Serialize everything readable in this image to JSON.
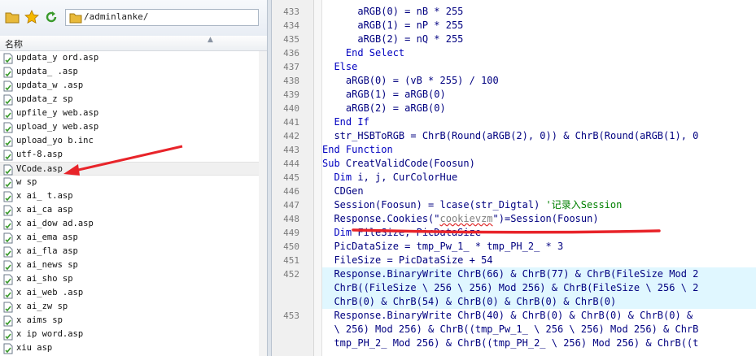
{
  "toolbar": {
    "path": "/adminlanke/",
    "icons": [
      "folder-icon",
      "star-icon",
      "refresh-icon"
    ]
  },
  "filelist": {
    "column_header": "名称",
    "files": [
      "updata_y     ord.asp",
      "updata_     .asp",
      "updata_w     .asp",
      "updata_z    sp",
      "upfile_y    web.asp",
      "upload_y    web.asp",
      "upload_yo     b.inc",
      "utf-8.asp",
      "VCode.asp",
      "w       sp",
      "x     ai_     t.asp",
      "x     ai_ca     asp",
      "x     ai_dow     ad.asp",
      "x     ai_ema     asp",
      "x     ai_fla     asp",
      "x     ai_news     sp",
      "x     ai_sho     sp",
      "x     ai_web     .asp",
      "x     ai_zw     sp",
      "x     aims     sp",
      "x     ip     word.asp",
      "xiu       asp"
    ],
    "selected_index": 8
  },
  "editor": {
    "lines": [
      {
        "num": "433",
        "text": "      aRGB(0) = nB * 255"
      },
      {
        "num": "434",
        "text": "      aRGB(1) = nP * 255"
      },
      {
        "num": "435",
        "text": "      aRGB(2) = nQ * 255"
      },
      {
        "num": "436",
        "text": "    End Select"
      },
      {
        "num": "437",
        "text": "  Else"
      },
      {
        "num": "438",
        "text": "    aRGB(0) = (vB * 255) / 100"
      },
      {
        "num": "439",
        "text": "    aRGB(1) = aRGB(0)"
      },
      {
        "num": "440",
        "text": "    aRGB(2) = aRGB(0)"
      },
      {
        "num": "441",
        "text": "  End If"
      },
      {
        "num": "442",
        "text": "  str_HSBToRGB = ChrB(Round(aRGB(2), 0)) & ChrB(Round(aRGB(1), 0"
      },
      {
        "num": "443",
        "text": "End Function"
      },
      {
        "num": "444",
        "text": "Sub CreatValidCode(Foosun)"
      },
      {
        "num": "445",
        "text": "  Dim i, j, CurColorHue"
      },
      {
        "num": "446",
        "text": "  CDGen"
      },
      {
        "num": "447",
        "text": "  Session(Foosun) = lcase(str_Digtal) '记录入Session"
      },
      {
        "num": "448",
        "text": "  Response.Cookies(\"cookievzm\")=Session(Foosun)"
      },
      {
        "num": "449",
        "text": "  Dim FileSize, PicDataSize"
      },
      {
        "num": "450",
        "text": "  PicDataSize = tmp_Pw_1_ * tmp_PH_2_ * 3"
      },
      {
        "num": "451",
        "text": "  FileSize = PicDataSize + 54"
      },
      {
        "num": "452",
        "text": "  Response.BinaryWrite ChrB(66) & ChrB(77) & ChrB(FileSize Mod 2"
      },
      {
        "num": "",
        "text": "  ChrB((FileSize \\ 256 \\ 256) Mod 256) & ChrB(FileSize \\ 256 \\ 2"
      },
      {
        "num": "",
        "text": "  ChrB(0) & ChrB(54) & ChrB(0) & ChrB(0) & ChrB(0)"
      },
      {
        "num": "453",
        "text": "  Response.BinaryWrite ChrB(40) & ChrB(0) & ChrB(0) & ChrB(0) &"
      },
      {
        "num": "",
        "text": "  \\ 256) Mod 256) & ChrB((tmp_Pw_1_ \\ 256 \\ 256) Mod 256) & ChrB"
      },
      {
        "num": "",
        "text": "  tmp_PH_2_ Mod 256) & ChrB((tmp_PH_2_ \\ 256) Mod 256) & ChrB((t"
      }
    ]
  },
  "colors": {
    "annotation": "#e8242a",
    "highlight": "#e0f7ff",
    "keyword": "#0000c0",
    "comment": "#008000"
  }
}
